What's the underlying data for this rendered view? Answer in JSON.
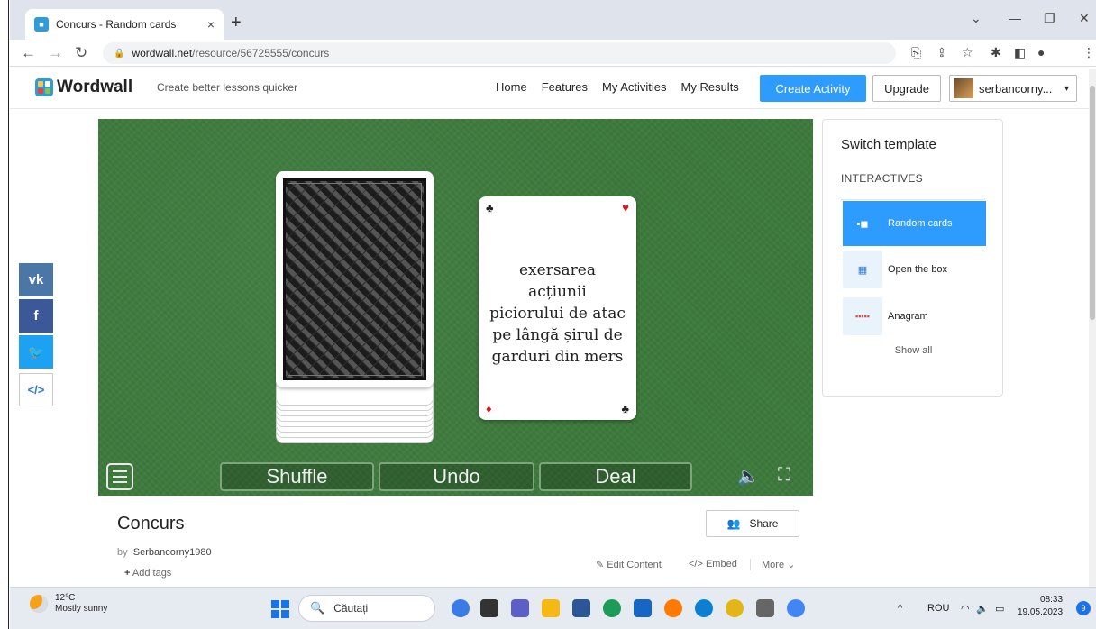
{
  "browser": {
    "tab_title": "Concurs - Random cards",
    "tab_close": "×",
    "new_tab": "+",
    "url_host": "wordwall.net",
    "url_path": "/resource/56725555/concurs"
  },
  "site": {
    "logo": "Wordwall",
    "tagline": "Create better lessons quicker",
    "nav": [
      "Home",
      "Features",
      "My Activities",
      "My Results"
    ],
    "create_label": "Create Activity",
    "upgrade_label": "Upgrade",
    "user_label": "serbancorny..."
  },
  "share_rail": [
    {
      "name": "vk",
      "label": "vk",
      "color": "#4a76a8"
    },
    {
      "name": "facebook",
      "label": "f",
      "color": "#3b5998"
    },
    {
      "name": "twitter",
      "label": "🐦",
      "color": "#1da1f2"
    },
    {
      "name": "embed",
      "label": "</>",
      "color": "#ffffff"
    }
  ],
  "game": {
    "card_text": "exersarea acțiunii piciorului de atac pe lângă șirul de garduri din mers",
    "pips": {
      "top_left": "♣",
      "top_right": "♥",
      "bottom_left": "♦",
      "bottom_right": "♣"
    },
    "buttons": {
      "shuffle": "Shuffle",
      "undo": "Undo",
      "deal": "Deal"
    },
    "sound_icon": "🔈",
    "fullscreen_icon": "⛶"
  },
  "panel": {
    "title": "Switch template",
    "section": "INTERACTIVES",
    "templates": [
      {
        "label": "Random cards",
        "selected": true
      },
      {
        "label": "Open the box",
        "selected": false
      },
      {
        "label": "Anagram",
        "selected": false
      }
    ],
    "show_all": "Show all"
  },
  "activity": {
    "title": "Concurs",
    "by": "by",
    "author": "Serbancorny1980",
    "add_tags": "Add tags",
    "share_label": "Share",
    "edit_label": "Edit Content",
    "embed_label": "Embed",
    "more_label": "More"
  },
  "taskbar": {
    "temp": "12°C",
    "weather": "Mostly sunny",
    "search_placeholder": "Căutați",
    "lang": "ROU",
    "time": "08:33",
    "date": "19.05.2023",
    "notifications": "9"
  }
}
